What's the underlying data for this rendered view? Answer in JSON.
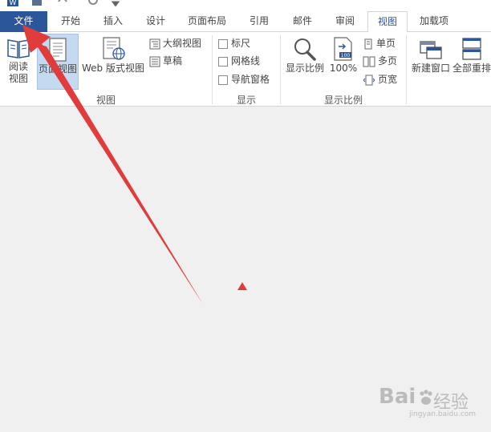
{
  "tabs": {
    "file": "文件",
    "home": "开始",
    "insert": "插入",
    "design": "设计",
    "layout": "页面布局",
    "references": "引用",
    "mailings": "邮件",
    "review": "审阅",
    "view": "视图",
    "addins": "加载项"
  },
  "ribbon": {
    "views": {
      "read_mode_line1": "阅读",
      "read_mode_line2": "视图",
      "print_layout": "页面视图",
      "web_layout": "Web 版式视图",
      "outline": "大纲视图",
      "draft": "草稿",
      "group_label": "视图"
    },
    "show": {
      "ruler": "标尺",
      "gridlines": "网格线",
      "nav_pane": "导航窗格",
      "group_label": "显示"
    },
    "zoom": {
      "zoom": "显示比例",
      "hundred": "100%",
      "one_page": "单页",
      "multi_page": "多页",
      "page_width": "页宽",
      "group_label": "显示比例"
    },
    "window": {
      "new_window": "新建窗口",
      "arrange_all": "全部重排"
    }
  },
  "watermark": {
    "logo": "Bai",
    "text": "经验",
    "url": "jingyan.baidu.com"
  },
  "colors": {
    "accent": "#2b579a",
    "annotation": "#e03c3c",
    "selected": "#c5d9f1"
  }
}
